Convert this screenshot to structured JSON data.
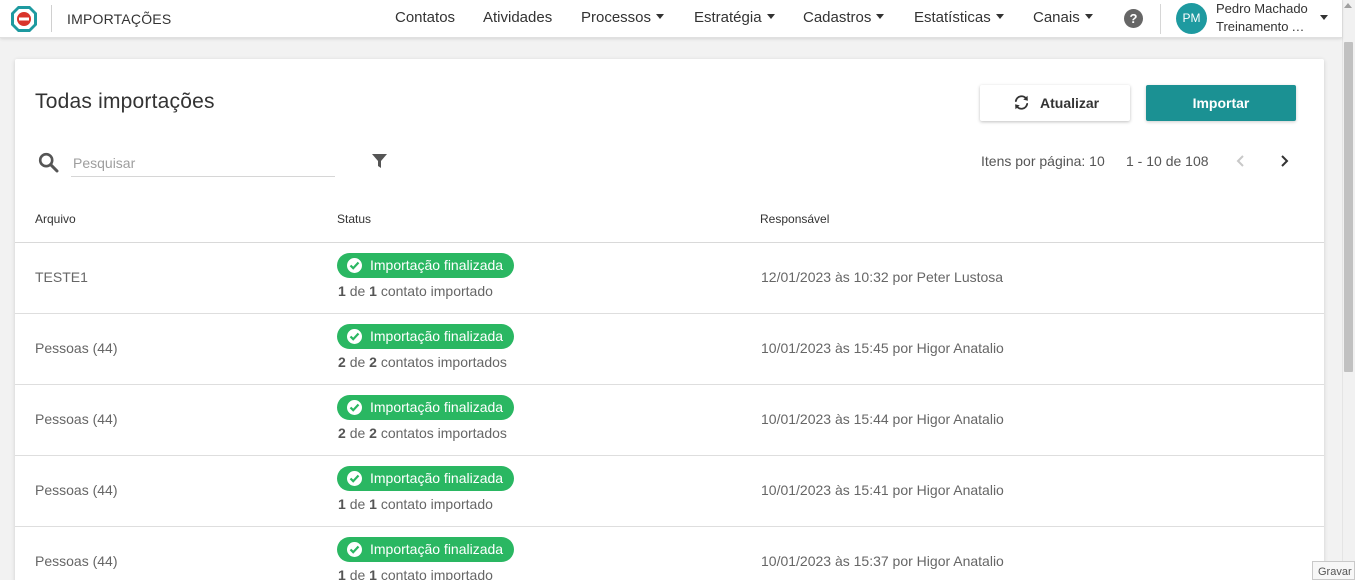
{
  "header": {
    "module_title": "IMPORTAÇÕES",
    "nav": [
      {
        "label": "Contatos"
      },
      {
        "label": "Atividades"
      },
      {
        "label": "Processos"
      },
      {
        "label": "Estratégia"
      },
      {
        "label": "Cadastros"
      },
      {
        "label": "Estatísticas"
      },
      {
        "label": "Canais"
      }
    ],
    "help_glyph": "?",
    "user": {
      "initials": "PM",
      "name": "Pedro Machado",
      "org": "Treinamento At..."
    }
  },
  "page": {
    "title": "Todas importações",
    "refresh_label": "Atualizar",
    "import_label": "Importar",
    "search_placeholder": "Pesquisar",
    "per_page_label": "Itens por página: 10",
    "range_label": "1 - 10 de 108"
  },
  "table": {
    "columns": {
      "file": "Arquivo",
      "status": "Status",
      "responsible": "Responsável"
    },
    "rows": [
      {
        "file": "TESTE1",
        "status": "Importação finalizada",
        "imported": "1",
        "de": "de",
        "total": "1",
        "suffix": "contato importado",
        "responsible": "12/01/2023 às 10:32 por Peter Lustosa"
      },
      {
        "file": "Pessoas (44)",
        "status": "Importação finalizada",
        "imported": "2",
        "de": "de",
        "total": "2",
        "suffix": "contatos importados",
        "responsible": "10/01/2023 às 15:45 por Higor Anatalio"
      },
      {
        "file": "Pessoas (44)",
        "status": "Importação finalizada",
        "imported": "2",
        "de": "de",
        "total": "2",
        "suffix": "contatos importados",
        "responsible": "10/01/2023 às 15:44 por Higor Anatalio"
      },
      {
        "file": "Pessoas (44)",
        "status": "Importação finalizada",
        "imported": "1",
        "de": "de",
        "total": "1",
        "suffix": "contato importado",
        "responsible": "10/01/2023 às 15:41 por Higor Anatalio"
      },
      {
        "file": "Pessoas (44)",
        "status": "Importação finalizada",
        "imported": "1",
        "de": "de",
        "total": "1",
        "suffix": "contato importado",
        "responsible": "10/01/2023 às 15:37 por Higor Anatalio"
      }
    ]
  },
  "overlay": {
    "gravar_label": "Gravar"
  },
  "icons": {
    "logo": "app-logo-icon",
    "search": "search-icon",
    "filter": "filter-icon",
    "refresh": "refresh-icon",
    "status": "check-circle-icon",
    "prev": "chevron-left-icon",
    "next": "chevron-right-icon"
  },
  "colors": {
    "accent": "#1b9193",
    "avatar": "#1e9aa0",
    "status_success": "#2ab762",
    "logo_red": "#d9342b",
    "logo_teal": "#1e9aa0"
  }
}
